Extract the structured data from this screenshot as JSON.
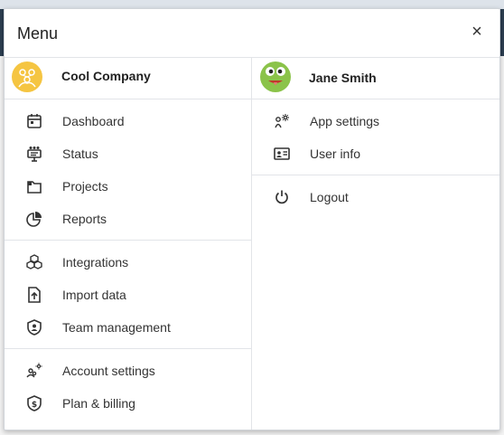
{
  "menu": {
    "title": "Menu",
    "close_label": "×"
  },
  "company": {
    "name": "Cool Company",
    "avatar_color": "#f5c542"
  },
  "user": {
    "name": "Jane Smith",
    "avatar_color": "#8bc34a"
  },
  "left_sections": [
    {
      "items": [
        {
          "label": "Dashboard",
          "icon": "calendar-icon"
        },
        {
          "label": "Status",
          "icon": "status-board-icon"
        },
        {
          "label": "Projects",
          "icon": "folder-icon"
        },
        {
          "label": "Reports",
          "icon": "pie-chart-icon"
        }
      ]
    },
    {
      "items": [
        {
          "label": "Integrations",
          "icon": "cubes-icon"
        },
        {
          "label": "Import data",
          "icon": "upload-file-icon"
        },
        {
          "label": "Team management",
          "icon": "shield-user-icon"
        }
      ]
    },
    {
      "items": [
        {
          "label": "Account settings",
          "icon": "users-gear-icon"
        },
        {
          "label": "Plan & billing",
          "icon": "shield-dollar-icon"
        }
      ]
    }
  ],
  "right_sections": [
    {
      "items": [
        {
          "label": "App settings",
          "icon": "user-gear-icon"
        },
        {
          "label": "User info",
          "icon": "id-card-icon"
        }
      ]
    },
    {
      "items": [
        {
          "label": "Logout",
          "icon": "power-icon"
        }
      ]
    }
  ]
}
